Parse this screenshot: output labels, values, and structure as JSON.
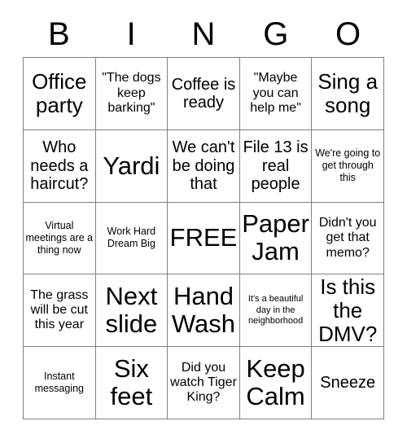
{
  "header": {
    "letters": [
      "B",
      "I",
      "N",
      "G",
      "O"
    ]
  },
  "grid": {
    "rows": 5,
    "columns": 5,
    "free_space_label": "FREE",
    "cells": [
      [
        {
          "text": "Office party",
          "size": "lg"
        },
        {
          "text": "\"The dogs keep barking\"",
          "size": "sm"
        },
        {
          "text": "Coffee is ready",
          "size": "md"
        },
        {
          "text": "\"Maybe you can help me\"",
          "size": "sm"
        },
        {
          "text": "Sing a song",
          "size": "lg"
        }
      ],
      [
        {
          "text": "Who needs a haircut?",
          "size": "md"
        },
        {
          "text": "Yardi",
          "size": "xl"
        },
        {
          "text": "We can't be doing that",
          "size": "md"
        },
        {
          "text": "File 13 is real people",
          "size": "md"
        },
        {
          "text": "We're going to get through this",
          "size": "xs"
        }
      ],
      [
        {
          "text": "Virtual meetings are a thing now",
          "size": "xs"
        },
        {
          "text": "Work Hard Dream Big",
          "size": "xs"
        },
        {
          "text": "FREE",
          "size": "xl"
        },
        {
          "text": "Paper Jam",
          "size": "xl"
        },
        {
          "text": "Didn't you get that memo?",
          "size": "sm"
        }
      ],
      [
        {
          "text": "The grass will be cut this year",
          "size": "sm"
        },
        {
          "text": "Next slide",
          "size": "xl"
        },
        {
          "text": "Hand Wash",
          "size": "xl"
        },
        {
          "text": "It's a beautiful day in the neighborhood",
          "size": "xxs"
        },
        {
          "text": "Is this the DMV?",
          "size": "lg"
        }
      ],
      [
        {
          "text": "Instant messaging",
          "size": "xs"
        },
        {
          "text": "Six feet",
          "size": "xl"
        },
        {
          "text": "Did you watch Tiger King?",
          "size": "sm"
        },
        {
          "text": "Keep Calm",
          "size": "xl"
        },
        {
          "text": "Sneeze",
          "size": "md"
        }
      ]
    ]
  },
  "colors": {
    "background": "#ffffff",
    "text": "#000000",
    "grid_line": "#808080"
  }
}
